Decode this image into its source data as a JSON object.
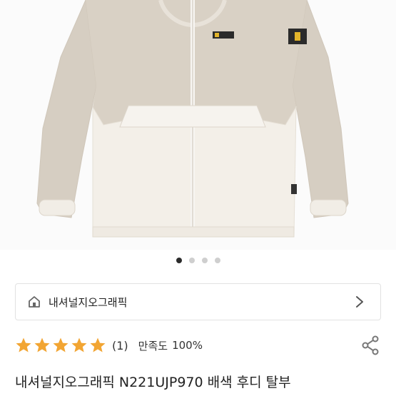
{
  "product": {
    "image_alt": "jacket photo",
    "carousel": {
      "total": 4,
      "active_index": 0
    },
    "brand": {
      "name": "내셔널지오그래픽"
    },
    "rating": {
      "stars": 5,
      "review_count": "(1)",
      "satisfaction_label": "만족도",
      "satisfaction_value": "100%"
    },
    "title": "내셔널지오그래픽 N221UJP970 배색 후디 탈부"
  },
  "colors": {
    "star": "#f2a533",
    "beige": "#d9d1c5",
    "cream": "#f3efe8",
    "active_dot": "#2b2b2b",
    "inactive_dot": "#cfcfcf"
  },
  "icons": {
    "home": "home-icon",
    "chevron": "chevron-right-icon",
    "share": "share-icon",
    "star": "star-icon"
  }
}
